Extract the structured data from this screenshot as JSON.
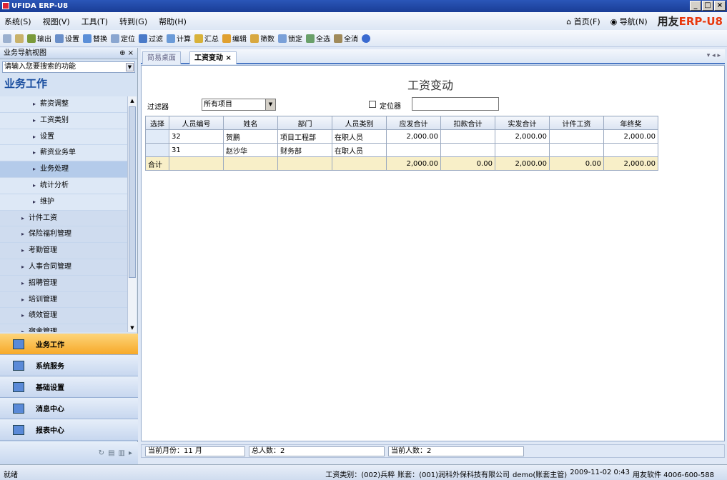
{
  "window": {
    "title": "UFIDA ERP-U8"
  },
  "menu": [
    "系统(S)",
    "视图(V)",
    "工具(T)",
    "转到(G)",
    "帮助(H)"
  ],
  "menu_right": {
    "home": "首页(F)",
    "nav": "导航(N)",
    "brand_prefix": "用友",
    "brand_suffix": "ERP-U8"
  },
  "toolbar": [
    "输出",
    "设置",
    "替换",
    "定位",
    "过滤",
    "计算",
    "汇总",
    "编辑",
    "筛数",
    "锁定",
    "全选",
    "全消"
  ],
  "nav": {
    "header": "业务导航视图",
    "search_placeholder": "请输入您要搜索的功能",
    "section_title": "业务工作",
    "items": [
      {
        "label": "薪资调整",
        "level": "sub"
      },
      {
        "label": "工资类别",
        "level": "sub"
      },
      {
        "label": "设置",
        "level": "sub"
      },
      {
        "label": "薪资业务单",
        "level": "sub"
      },
      {
        "label": "业务处理",
        "level": "sub",
        "selected": true
      },
      {
        "label": "统计分析",
        "level": "sub"
      },
      {
        "label": "维护",
        "level": "sub"
      },
      {
        "label": "计件工资",
        "level": "top"
      },
      {
        "label": "保险福利管理",
        "level": "top"
      },
      {
        "label": "考勤管理",
        "level": "top"
      },
      {
        "label": "人事合同管理",
        "level": "top"
      },
      {
        "label": "招聘管理",
        "level": "top"
      },
      {
        "label": "培训管理",
        "level": "top"
      },
      {
        "label": "绩效管理",
        "level": "top"
      },
      {
        "label": "宿舍管理",
        "level": "top"
      }
    ],
    "panels": [
      "业务工作",
      "系统服务",
      "基础设置",
      "消息中心",
      "报表中心"
    ]
  },
  "tabs": [
    "简易桌面",
    "工资变动"
  ],
  "content": {
    "title": "工资变动",
    "filter_label": "过滤器",
    "filter_value": "所有项目",
    "locator_label": "定位器",
    "columns": [
      "选择",
      "人员编号",
      "姓名",
      "部门",
      "人员类别",
      "应发合计",
      "扣款合计",
      "实发合计",
      "计件工资",
      "年终奖"
    ],
    "rows": [
      [
        "",
        "32",
        "贺鹏",
        "项目工程部",
        "在职人员",
        "2,000.00",
        "",
        "2,000.00",
        "",
        "2,000.00"
      ],
      [
        "",
        "31",
        "赵沙华",
        "财务部",
        "在职人员",
        "",
        "",
        "",
        "",
        ""
      ]
    ],
    "total": [
      "合计",
      "",
      "",
      "",
      "",
      "2,000.00",
      "0.00",
      "2,000.00",
      "0.00",
      "2,000.00"
    ]
  },
  "status": {
    "month": "当前月份：11 月",
    "total_people": "总人数：2",
    "current_people": "当前人数：2",
    "ready": "就绪",
    "right": [
      "工资类别：(002)兵粹",
      "账套：(001)润科外保科技有限公司",
      "demo(账套主管)",
      "2009-11-02 0:43",
      "用友软件 4006-600-588"
    ]
  },
  "colors": {
    "accent": "#f7a928",
    "title_blue": "#1b4fa0",
    "brand_red": "#e8380d"
  }
}
